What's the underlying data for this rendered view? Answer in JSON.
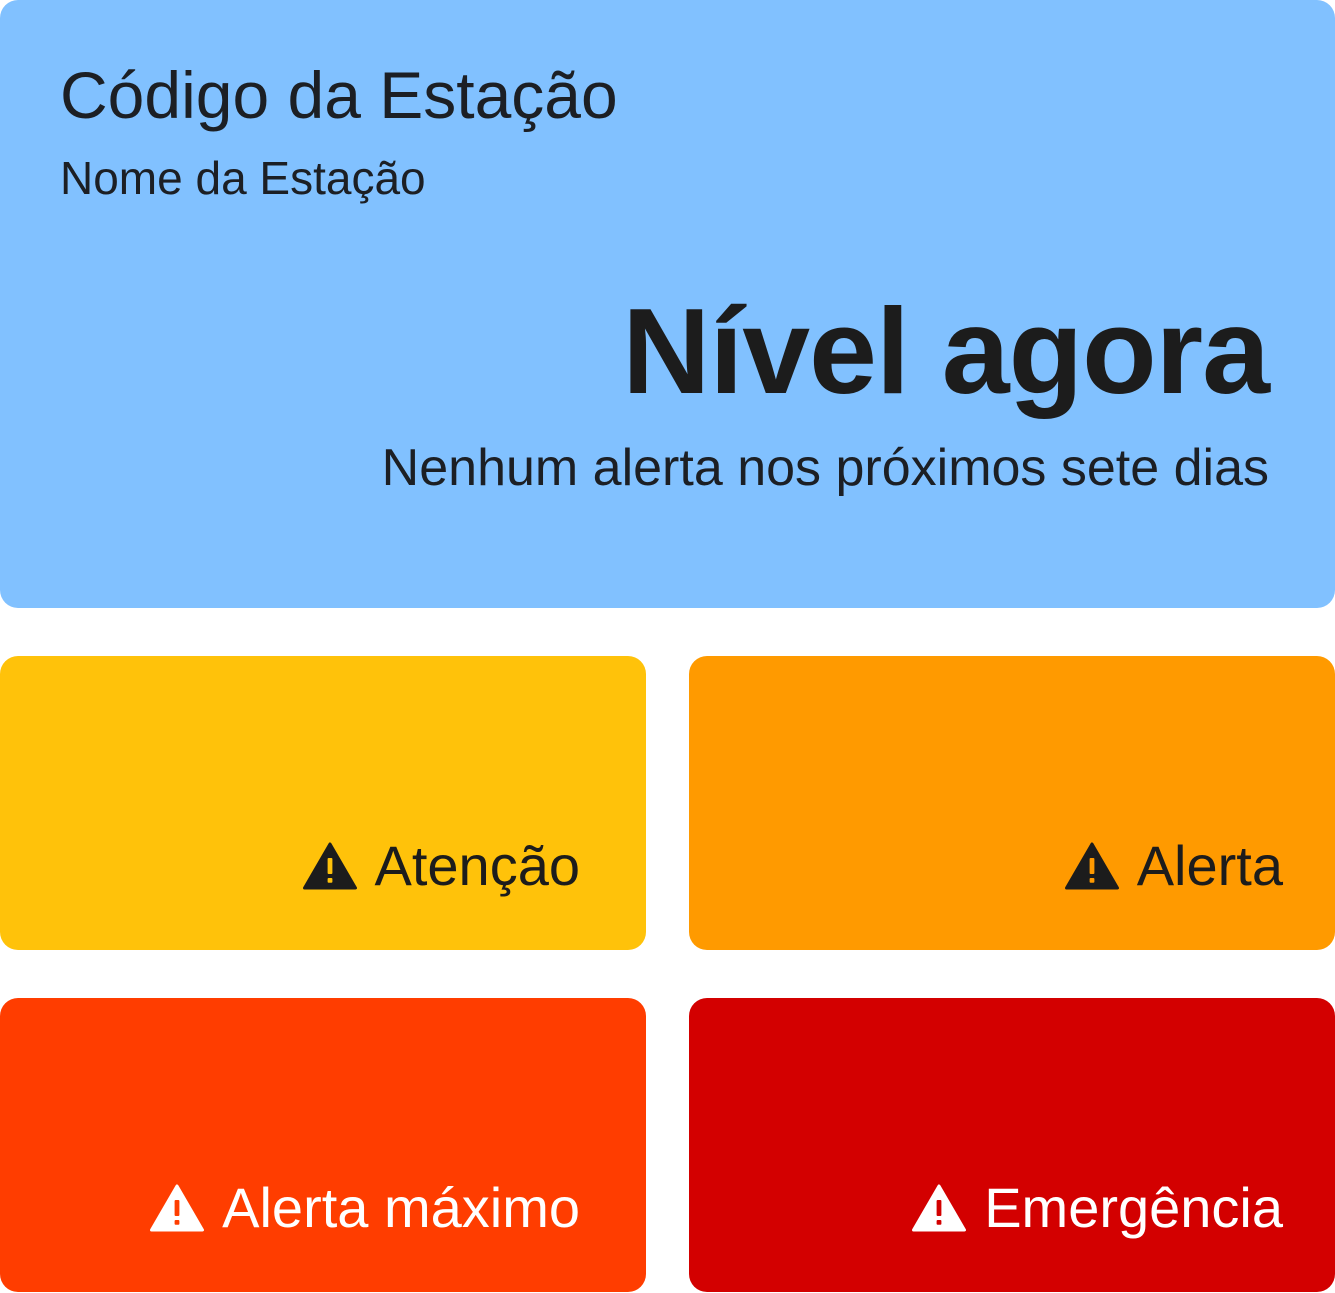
{
  "station": {
    "code": "Código da Estação",
    "name": "Nome da Estação",
    "level_now": "Nível agora",
    "alert_summary": "Nenhum alerta nos próximos sete dias",
    "bg_color": "#81c1ff"
  },
  "levels": [
    {
      "label": "Atenção",
      "icon": "warning-icon",
      "bg_color": "#ffc20a",
      "text_color": "#1c1c1c"
    },
    {
      "label": "Alerta",
      "icon": "warning-icon",
      "bg_color": "#ff9a00",
      "text_color": "#1c1c1c"
    },
    {
      "label": "Alerta máximo",
      "icon": "warning-icon",
      "bg_color": "#ff3d00",
      "text_color": "#ffffff"
    },
    {
      "label": "Emergência",
      "icon": "warning-icon",
      "bg_color": "#d30000",
      "text_color": "#ffffff"
    }
  ]
}
